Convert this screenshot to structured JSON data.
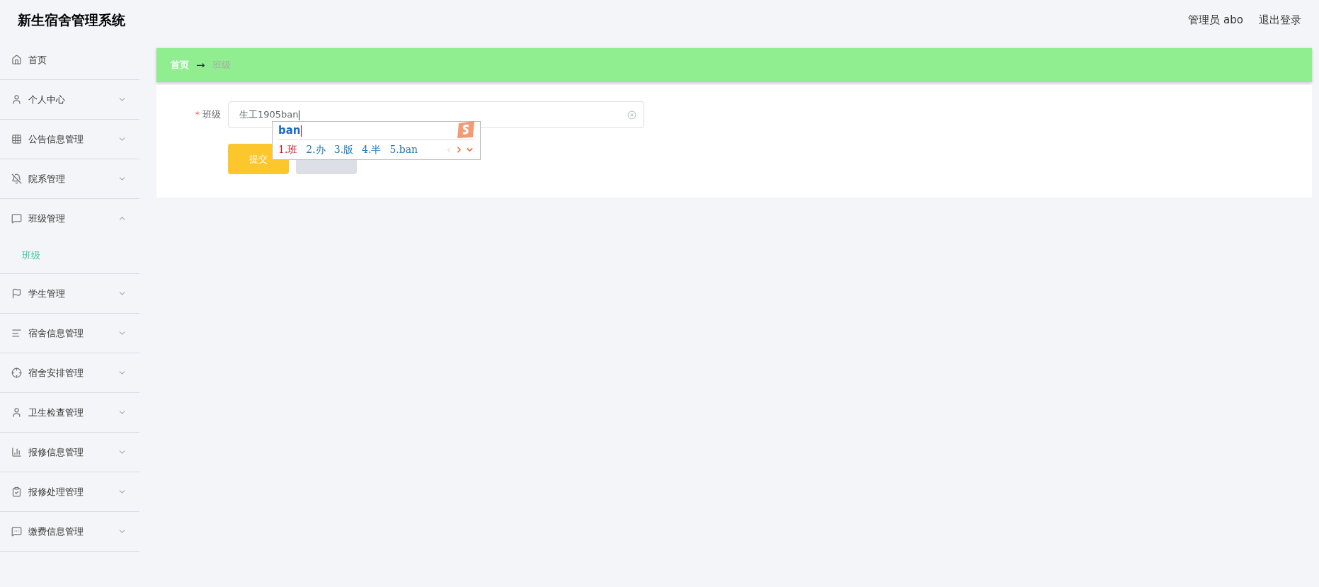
{
  "header": {
    "title": "新生宿舍管理系统",
    "user": "管理员 abo",
    "logout": "退出登录"
  },
  "sidebar": {
    "items": [
      {
        "label": "首页",
        "kind": "link"
      },
      {
        "label": "个人中心",
        "kind": "menu",
        "expanded": false
      },
      {
        "label": "公告信息管理",
        "kind": "menu",
        "expanded": false
      },
      {
        "label": "院系管理",
        "kind": "menu",
        "expanded": false
      },
      {
        "label": "班级管理",
        "kind": "menu",
        "expanded": true,
        "children": [
          {
            "label": "班级",
            "selected": true
          }
        ]
      },
      {
        "label": "学生管理",
        "kind": "menu",
        "expanded": false
      },
      {
        "label": "宿舍信息管理",
        "kind": "menu",
        "expanded": false
      },
      {
        "label": "宿舍安排管理",
        "kind": "menu",
        "expanded": false
      },
      {
        "label": "卫生检查管理",
        "kind": "menu",
        "expanded": false
      },
      {
        "label": "报修信息管理",
        "kind": "menu",
        "expanded": false
      },
      {
        "label": "报修处理管理",
        "kind": "menu",
        "expanded": false
      },
      {
        "label": "缴费信息管理",
        "kind": "menu",
        "expanded": false
      }
    ]
  },
  "breadcrumb": [
    "首页",
    "班级"
  ],
  "breadcrumb_separator": "→",
  "form": {
    "field": {
      "label": "班级",
      "required_mark": "*",
      "value": "生工1905ban"
    },
    "submit": "提交"
  },
  "ime": {
    "composition": "ban",
    "candidates": [
      {
        "label": "1.班",
        "selected": true
      },
      {
        "label": "2.办",
        "selected": false
      },
      {
        "label": "3.版",
        "selected": false
      },
      {
        "label": "4.半",
        "selected": false
      },
      {
        "label": "5.ban",
        "selected": false
      }
    ]
  }
}
